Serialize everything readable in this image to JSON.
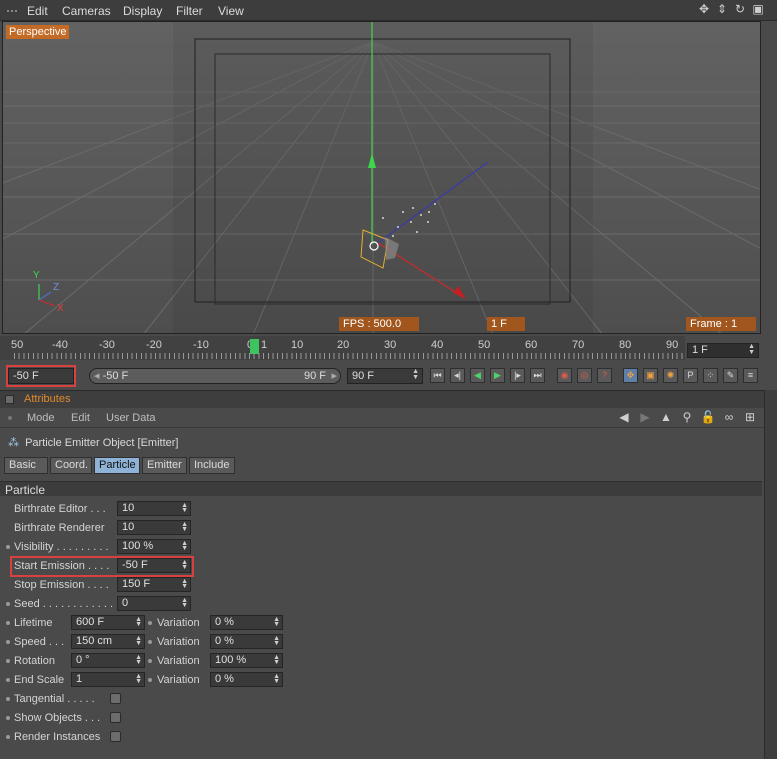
{
  "viewport_menu": {
    "items": [
      "Edit",
      "Cameras",
      "Display",
      "Filter",
      "View"
    ]
  },
  "viewport": {
    "label": "Perspective",
    "fps": "FPS : 500.0",
    "current_frame": "1 F",
    "frame_readout": "Frame : 1",
    "axis_y": "Y",
    "axis_z": "Z",
    "axis_x": "X"
  },
  "timeline": {
    "tick_labels": [
      "50",
      "-40",
      "-30",
      "-20",
      "-10",
      "0",
      "1",
      "10",
      "20",
      "30",
      "40",
      "50",
      "60",
      "70",
      "80",
      "90"
    ],
    "frame_field": "1 F",
    "start_field": "-50 F",
    "range_start": "-50 F",
    "range_end": "90 F",
    "end_field": "90 F"
  },
  "attributes": {
    "header": "Attributes",
    "menu": [
      "Mode",
      "Edit",
      "User Data"
    ],
    "object_title": "Particle Emitter Object [Emitter]",
    "tabs": [
      "Basic",
      "Coord.",
      "Particle",
      "Emitter",
      "Include"
    ],
    "active_tab": "Particle",
    "section": "Particle",
    "params": {
      "birthrate_editor": {
        "label": "Birthrate Editor . . .",
        "value": "10"
      },
      "birthrate_renderer": {
        "label": "Birthrate Renderer",
        "value": "10"
      },
      "visibility": {
        "label": "Visibility . . . . . . . . .",
        "value": "100 %"
      },
      "start_emission": {
        "label": "Start Emission . . . .",
        "value": "-50 F"
      },
      "stop_emission": {
        "label": "Stop Emission . . . .",
        "value": "150 F"
      },
      "seed": {
        "label": "Seed . . . . . . . . . . . .",
        "value": "0"
      },
      "lifetime": {
        "label": "Lifetime",
        "value": "600 F",
        "variation_label": "Variation",
        "variation": "0 %"
      },
      "speed": {
        "label": "Speed . . .",
        "value": "150 cm",
        "variation_label": "Variation",
        "variation": "0 %"
      },
      "rotation": {
        "label": "Rotation",
        "value": "0 °",
        "variation_label": "Variation",
        "variation": "100 %"
      },
      "end_scale": {
        "label": "End Scale",
        "value": "1",
        "variation_label": "Variation",
        "variation": "0 %"
      },
      "tangential": {
        "label": "Tangential . . . . ."
      },
      "show_objects": {
        "label": "Show Objects . . ."
      },
      "render_instances": {
        "label": "Render Instances"
      }
    }
  },
  "colors": {
    "highlight": "#d94040",
    "accent_orange": "#c26a26",
    "playhead": "#3ec45f",
    "active_tab": "#8fb3d6"
  }
}
